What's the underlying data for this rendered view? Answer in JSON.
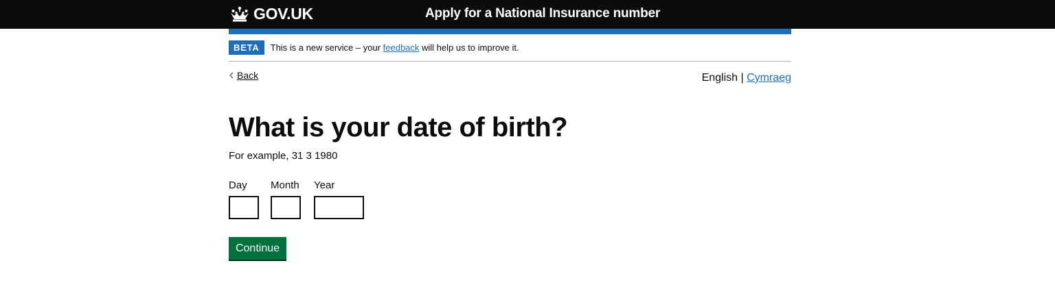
{
  "header": {
    "logo_text": "GOV.UK",
    "logo_icon": "crown-icon",
    "service_name": "Apply for a National Insurance number"
  },
  "phase_banner": {
    "tag": "BETA",
    "text_before": "This is a new service – your ",
    "link": "feedback",
    "text_after": " will help us to improve it."
  },
  "nav": {
    "back": "Back",
    "back_icon": "chevron-left-icon"
  },
  "language": {
    "current": "English",
    "separator": " | ",
    "other": "Cymraeg"
  },
  "form": {
    "title": "What is your date of birth?",
    "hint": "For example, 31 3 1980",
    "fields": {
      "day": {
        "label": "Day",
        "value": ""
      },
      "month": {
        "label": "Month",
        "value": ""
      },
      "year": {
        "label": "Year",
        "value": ""
      }
    },
    "submit": "Continue"
  },
  "colors": {
    "header_bg": "#0b0c0c",
    "brand_blue": "#1d70b8",
    "button_green": "#00703c",
    "text": "#0b0c0c",
    "border": "#b1b4b6"
  }
}
